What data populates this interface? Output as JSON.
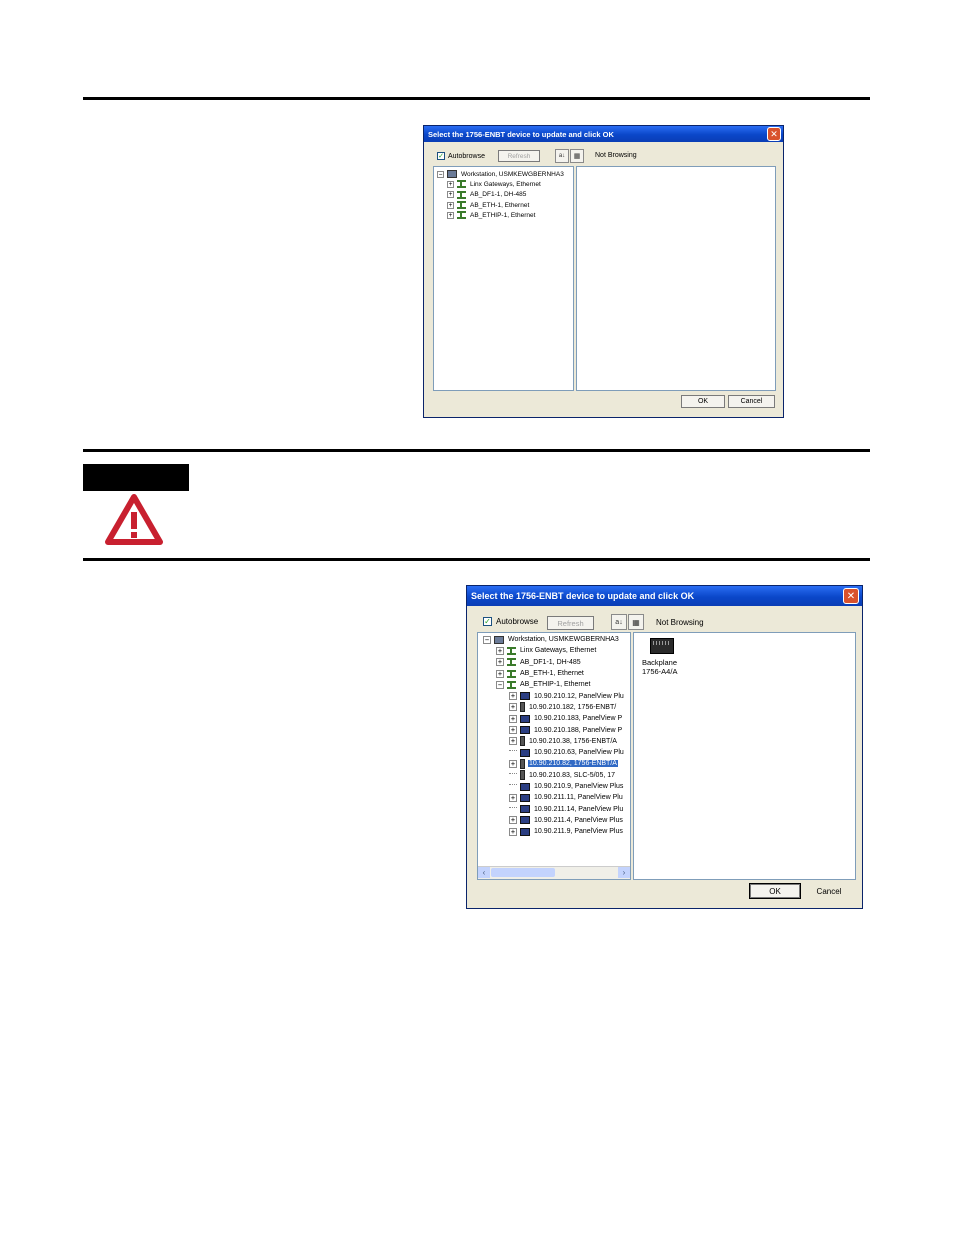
{
  "dialog_top": {
    "title": "Select the 1756-ENBT device to update and click OK",
    "autobrowse_label": "Autobrowse",
    "autobrowse_checked": true,
    "refresh_label": "Refresh",
    "status": "Not Browsing",
    "tree": [
      {
        "label": "Workstation, USMKEWGBERNHA3",
        "level": 0,
        "expander": "−"
      },
      {
        "label": "Linx Gateways, Ethernet",
        "level": 1,
        "expander": "+"
      },
      {
        "label": "AB_DF1-1, DH-485",
        "level": 1,
        "expander": "+"
      },
      {
        "label": "AB_ETH-1, Ethernet",
        "level": 1,
        "expander": "+"
      },
      {
        "label": "AB_ETHIP-1, Ethernet",
        "level": 1,
        "expander": "+"
      }
    ],
    "ok_label": "OK",
    "cancel_label": "Cancel"
  },
  "dialog_bottom": {
    "title": "Select the 1756-ENBT device to update and click OK",
    "autobrowse_label": "Autobrowse",
    "autobrowse_checked": true,
    "refresh_label": "Refresh",
    "status": "Not Browsing",
    "tree": [
      {
        "label": "Workstation, USMKEWGBERNHA3",
        "level": 0,
        "expander": "−"
      },
      {
        "label": "Linx Gateways, Ethernet",
        "level": 1,
        "expander": "+"
      },
      {
        "label": "AB_DF1-1, DH-485",
        "level": 1,
        "expander": "+"
      },
      {
        "label": "AB_ETH-1, Ethernet",
        "level": 1,
        "expander": "+"
      },
      {
        "label": "AB_ETHIP-1, Ethernet",
        "level": 1,
        "expander": "−"
      },
      {
        "label": "10.90.210.12, PanelView Plu",
        "level": 2,
        "expander": "+"
      },
      {
        "label": "10.90.210.182, 1756-ENBT/",
        "level": 2,
        "expander": "+"
      },
      {
        "label": "10.90.210.183, PanelView P",
        "level": 2,
        "expander": "+"
      },
      {
        "label": "10.90.210.188, PanelView P",
        "level": 2,
        "expander": "+"
      },
      {
        "label": "10.90.210.38, 1756-ENBT/A",
        "level": 2,
        "expander": "+"
      },
      {
        "label": "10.90.210.63, PanelView Plu",
        "level": 2,
        "expander": ""
      },
      {
        "label": "10.90.210.82, 1756-ENBT/A",
        "level": 2,
        "expander": "+",
        "selected": true
      },
      {
        "label": "10.90.210.83, SLC-5/05, 17",
        "level": 2,
        "expander": ""
      },
      {
        "label": "10.90.210.9, PanelView Plus",
        "level": 2,
        "expander": ""
      },
      {
        "label": "10.90.211.11, PanelView Plu",
        "level": 2,
        "expander": "+"
      },
      {
        "label": "10.90.211.14, PanelView Plu",
        "level": 2,
        "expander": ""
      },
      {
        "label": "10.90.211.4, PanelView Plus",
        "level": 2,
        "expander": "+"
      },
      {
        "label": "10.90.211.9, PanelView Plus",
        "level": 2,
        "expander": "+"
      }
    ],
    "device": {
      "name": "Backplane",
      "model": "1756-A4/A"
    },
    "ok_label": "OK",
    "cancel_label": "Cancel"
  },
  "colors": {
    "warning_red": "#c8202f",
    "titlebar_blue": "#0a47c9",
    "selection": "#316ac5"
  }
}
